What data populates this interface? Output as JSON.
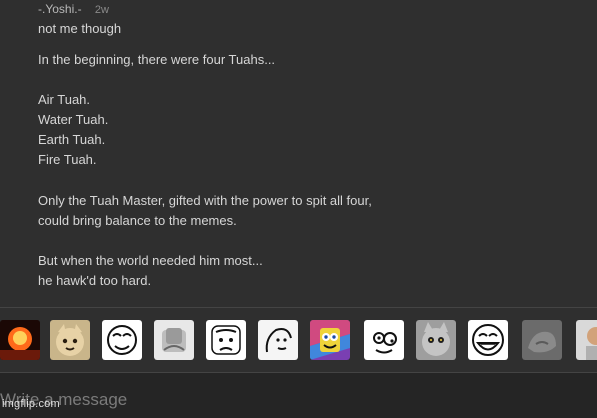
{
  "message": {
    "username": "-.Yoshi.-",
    "time_ago": "2w",
    "reply_text": "not me though",
    "body_lines": [
      "In the beginning, there were four Tuahs...",
      "Air Tuah.",
      "Water Tuah.",
      "Earth Tuah.",
      "Fire Tuah.",
      "Only the Tuah Master, gifted with the power to spit all four,",
      "could bring balance to the memes.",
      "But when the world needed him most...",
      "he hawk'd too hard."
    ]
  },
  "meme_bar": {
    "items": [
      {
        "icon": "explosion-meme-icon"
      },
      {
        "icon": "cat-meme-icon"
      },
      {
        "icon": "rage-face-meme-icon"
      },
      {
        "icon": "facepalm-meme-icon"
      },
      {
        "icon": "okay-face-meme-icon"
      },
      {
        "icon": "thinking-face-meme-icon"
      },
      {
        "icon": "spongebob-meme-icon"
      },
      {
        "icon": "derp-face-meme-icon"
      },
      {
        "icon": "angry-cat-meme-icon"
      },
      {
        "icon": "lol-face-meme-icon"
      },
      {
        "icon": "rock-meme-icon"
      },
      {
        "icon": "man-meme-icon"
      }
    ]
  },
  "composer": {
    "placeholder": "Write a message"
  },
  "watermark": "imgflip.com",
  "colors": {
    "background": "#2f2f2f",
    "composer_background": "#252525",
    "text": "#d6d6d6"
  }
}
